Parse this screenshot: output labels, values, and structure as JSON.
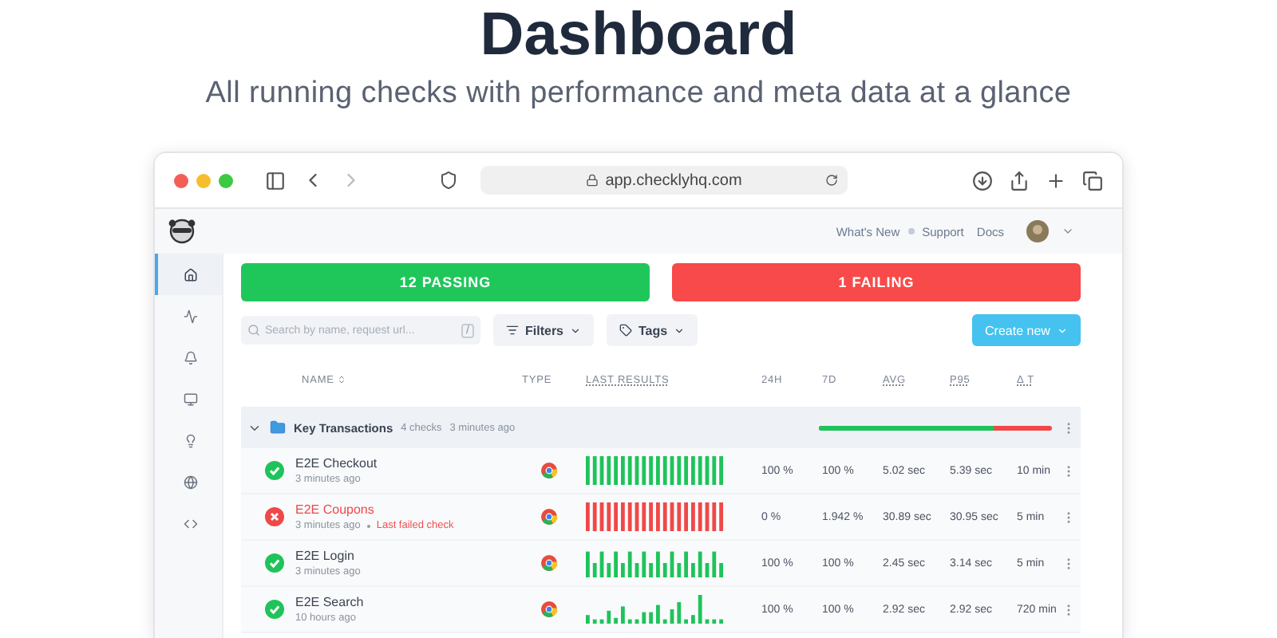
{
  "heading": "Dashboard",
  "subtitle": "All running checks with performance and meta data at a glance",
  "browser": {
    "url": "app.checklyhq.com"
  },
  "header": {
    "links": [
      "What's New",
      "Support",
      "Docs"
    ]
  },
  "sidebar": {
    "items": [
      {
        "selected": true
      },
      {
        "selected": false
      },
      {
        "selected": false
      },
      {
        "selected": false
      },
      {
        "selected": false
      },
      {
        "selected": false
      },
      {
        "selected": false
      }
    ]
  },
  "summary": [
    {
      "kind": "passing",
      "label": "12 PASSING"
    },
    {
      "kind": "failing",
      "label": "1 FAILING"
    }
  ],
  "toolbar": {
    "search": {
      "placeholder": "Search by name, request url...",
      "shortcut": "/"
    },
    "filters": "Filters",
    "tags": "Tags",
    "create": "Create new"
  },
  "table": {
    "lead_columns": [
      "NAME",
      "TYPE",
      "LAST RESULTS"
    ],
    "columns": [
      "24H",
      "7D",
      "AVG",
      "P95",
      "Δ T"
    ],
    "group": {
      "name": "Key Transactions",
      "count": "4 checks",
      "time": "3 minutes ago",
      "expanded": true,
      "level": 0.75
    },
    "rows": [
      {
        "kind": "passing",
        "name": "E2E Checkout",
        "time": "3 minutes ago",
        "cells": [
          "100 %",
          "100 %",
          "5.02 sec",
          "5.39 sec",
          "10 min"
        ]
      },
      {
        "kind": "failing",
        "name": "E2E Coupons",
        "time": "3 minutes ago",
        "note": "Last failed check",
        "cells": [
          "0 %",
          "1.942 %",
          "30.89 sec",
          "30.95 sec",
          "5 min"
        ]
      },
      {
        "kind": "passing",
        "name": "E2E Login",
        "time": "3 minutes ago",
        "cells": [
          "100 %",
          "100 %",
          "2.45 sec",
          "3.14 sec",
          "5 min"
        ]
      },
      {
        "kind": "passing",
        "name": "E2E Search",
        "time": "10 hours ago",
        "cells": [
          "100 %",
          "100 %",
          "2.92 sec",
          "2.92 sec",
          "720 min"
        ]
      }
    ]
  }
}
